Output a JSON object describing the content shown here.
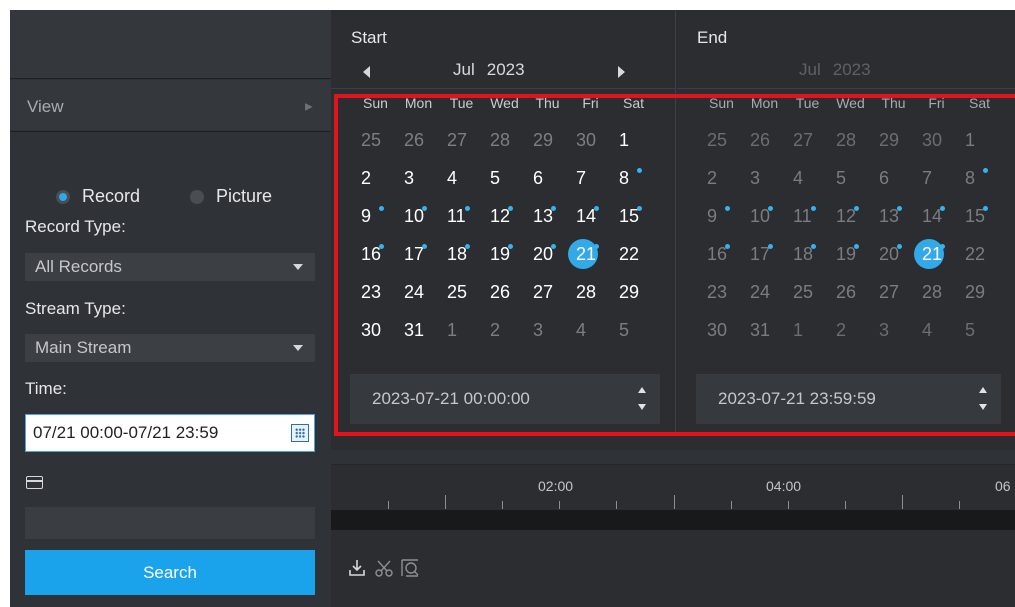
{
  "sidebar": {
    "view_label": "View",
    "mode_options": [
      {
        "label": "Record",
        "selected": true
      },
      {
        "label": "Picture",
        "selected": false
      }
    ],
    "record_type_label": "Record Type:",
    "record_type_value": "All Records",
    "stream_type_label": "Stream Type:",
    "stream_type_value": "Main Stream",
    "time_label": "Time:",
    "time_value": "07/21 00:00-07/21 23:59",
    "search_label": "Search"
  },
  "start_calendar": {
    "title": "Start",
    "month": "Jul",
    "year": "2023",
    "weekdays": [
      "Sun",
      "Mon",
      "Tue",
      "Wed",
      "Thu",
      "Fri",
      "Sat"
    ],
    "days": [
      "25",
      "26",
      "27",
      "28",
      "29",
      "30",
      "1",
      "2",
      "3",
      "4",
      "5",
      "6",
      "7",
      "8",
      "9",
      "10",
      "11",
      "12",
      "13",
      "14",
      "15",
      "16",
      "17",
      "18",
      "19",
      "20",
      "21",
      "22",
      "23",
      "24",
      "25",
      "26",
      "27",
      "28",
      "29",
      "30",
      "31",
      "1",
      "2",
      "3",
      "4",
      "5"
    ],
    "datetime": "2023-07-21 00:00:00"
  },
  "end_calendar": {
    "title": "End",
    "month": "Jul",
    "year": "2023",
    "weekdays": [
      "Sun",
      "Mon",
      "Tue",
      "Wed",
      "Thu",
      "Fri",
      "Sat"
    ],
    "days": [
      "25",
      "26",
      "27",
      "28",
      "29",
      "30",
      "1",
      "2",
      "3",
      "4",
      "5",
      "6",
      "7",
      "8",
      "9",
      "10",
      "11",
      "12",
      "13",
      "14",
      "15",
      "16",
      "17",
      "18",
      "19",
      "20",
      "21",
      "22",
      "23",
      "24",
      "25",
      "26",
      "27",
      "28",
      "29",
      "30",
      "31",
      "1",
      "2",
      "3",
      "4",
      "5"
    ],
    "datetime": "2023-07-21 23:59:59"
  },
  "calendar_state": {
    "other_month_indices": [
      0,
      1,
      2,
      3,
      4,
      5,
      37,
      38,
      39,
      40,
      41
    ],
    "record_marker_indices": [
      13,
      14,
      15,
      16,
      17,
      18,
      19,
      20,
      21,
      22,
      23,
      24,
      25,
      26
    ],
    "selected_index": 26
  },
  "timeline": {
    "labels": [
      "02:00",
      "04:00",
      "06"
    ]
  },
  "colors": {
    "accent": "#1aa3ea",
    "highlight_border": "#e4121c",
    "record_dot": "#35b2f0"
  },
  "toolbar_icons": [
    "download-icon",
    "scissors-icon",
    "zoom-frame-icon"
  ]
}
